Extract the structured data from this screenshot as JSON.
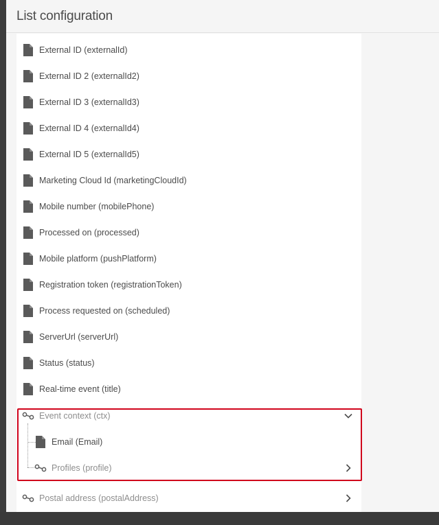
{
  "dialog": {
    "title": "List configuration"
  },
  "fields": [
    {
      "label": "External ID (externalId)",
      "icon": "file-icon"
    },
    {
      "label": "External ID 2 (externalId2)",
      "icon": "file-icon"
    },
    {
      "label": "External ID 3 (externalId3)",
      "icon": "file-icon"
    },
    {
      "label": "External ID 4 (externalId4)",
      "icon": "file-icon"
    },
    {
      "label": "External ID 5 (externalId5)",
      "icon": "file-icon"
    },
    {
      "label": "Marketing Cloud Id (marketingCloudId)",
      "icon": "file-icon"
    },
    {
      "label": "Mobile number (mobilePhone)",
      "icon": "file-icon"
    },
    {
      "label": "Processed on (processed)",
      "icon": "file-icon"
    },
    {
      "label": "Mobile platform (pushPlatform)",
      "icon": "file-icon"
    },
    {
      "label": "Registration token (registrationToken)",
      "icon": "file-icon"
    },
    {
      "label": "Process requested on (scheduled)",
      "icon": "file-icon"
    },
    {
      "label": "ServerUrl (serverUrl)",
      "icon": "file-icon"
    },
    {
      "label": "Status (status)",
      "icon": "file-icon"
    },
    {
      "label": "Real-time event (title)",
      "icon": "file-icon"
    }
  ],
  "event_context": {
    "label": "Event context (ctx)",
    "icon": "link-icon",
    "expanded": true,
    "children": [
      {
        "label": "Email (Email)",
        "icon": "file-icon"
      },
      {
        "label": "Profiles (profile)",
        "icon": "link-icon",
        "expandable": true
      }
    ]
  },
  "postal_address": {
    "label": "Postal address (postalAddress)",
    "icon": "link-icon",
    "expandable": true
  },
  "colors": {
    "highlight": "#d0021b",
    "text": "#4b4b4b",
    "muted_text": "#8e8e8e",
    "icon": "#5a5a5a"
  }
}
